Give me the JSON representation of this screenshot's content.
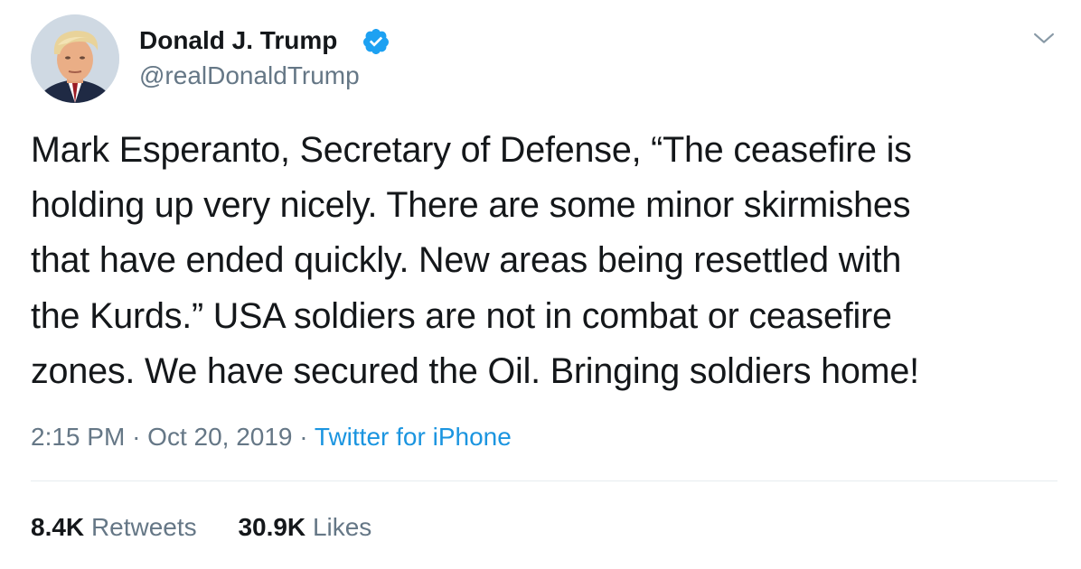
{
  "author": {
    "name": "Donald J. Trump",
    "handle": "@realDonaldTrump",
    "verified": true,
    "verified_color": "#1da1f2"
  },
  "tweet": {
    "lines": [
      "Mark Esperanto, Secretary of Defense, “The ceasefire is",
      "holding up very nicely. There are some minor skirmishes",
      "that have ended quickly. New areas being resettled with",
      "the Kurds.” USA soldiers are not in combat or ceasefire",
      "zones. We have secured the Oil. Bringing soldiers home!"
    ]
  },
  "meta": {
    "time": "2:15 PM",
    "separator": "·",
    "date": "Oct 20, 2019",
    "source": "Twitter for iPhone"
  },
  "stats": {
    "retweets_count": "8.4K",
    "retweets_label": "Retweets",
    "likes_count": "30.9K",
    "likes_label": "Likes"
  },
  "icons": {
    "verified": "verified-badge-icon",
    "menu": "chevron-down-icon"
  },
  "colors": {
    "text_primary": "#14171a",
    "text_secondary": "#657786",
    "link": "#1b95e0",
    "divider": "#e6ecf0"
  }
}
